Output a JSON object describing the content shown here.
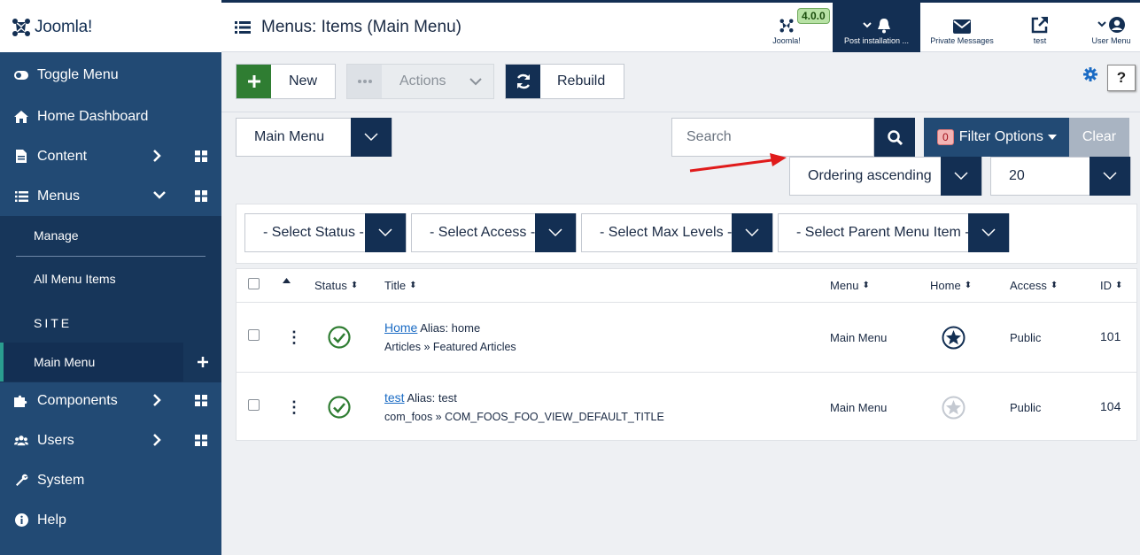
{
  "header": {
    "logo_text": "Joomla!",
    "page_title": "Menus: Items (Main Menu)",
    "version": "4.0.0",
    "items": {
      "joomla": "Joomla!",
      "post": "Post installation ...",
      "pm": "Private Messages",
      "test": "test",
      "user": "User Menu"
    }
  },
  "sidebar": {
    "toggle": "Toggle Menu",
    "home": "Home Dashboard",
    "content": "Content",
    "menus": "Menus",
    "manage": "Manage",
    "all_items": "All Menu Items",
    "site": "SITE",
    "main_menu": "Main Menu",
    "components": "Components",
    "users": "Users",
    "system": "System",
    "help": "Help"
  },
  "toolbar": {
    "new": "New",
    "actions": "Actions",
    "rebuild": "Rebuild",
    "help": "?"
  },
  "filters": {
    "menu": "Main Menu",
    "search_placeholder": "Search",
    "filter_options": "Filter Options",
    "filter_count": "0",
    "clear": "Clear",
    "ordering": "Ordering ascending",
    "limit": "20",
    "status": "- Select Status -",
    "access": "- Select Access -",
    "levels": "- Select Max Levels -",
    "parent": "- Select Parent Menu Item -"
  },
  "table": {
    "columns": {
      "status": "Status",
      "title": "Title",
      "menu": "Menu",
      "home": "Home",
      "access": "Access",
      "id": "ID"
    },
    "rows": [
      {
        "title": "Home",
        "alias": "Alias: home",
        "type": "Articles » Featured Articles",
        "menu": "Main Menu",
        "access": "Public",
        "id": "101",
        "home": true
      },
      {
        "title": "test",
        "alias": "Alias: test",
        "type": "com_foos » COM_FOOS_FOO_VIEW_DEFAULT_TITLE",
        "menu": "Main Menu",
        "access": "Public",
        "id": "104",
        "home": false
      }
    ]
  },
  "colors": {
    "navy": "#132f53",
    "sidebar": "#224a74",
    "green": "#2f7d32",
    "link": "#1a6bc4",
    "arrow": "#e01b1b"
  }
}
